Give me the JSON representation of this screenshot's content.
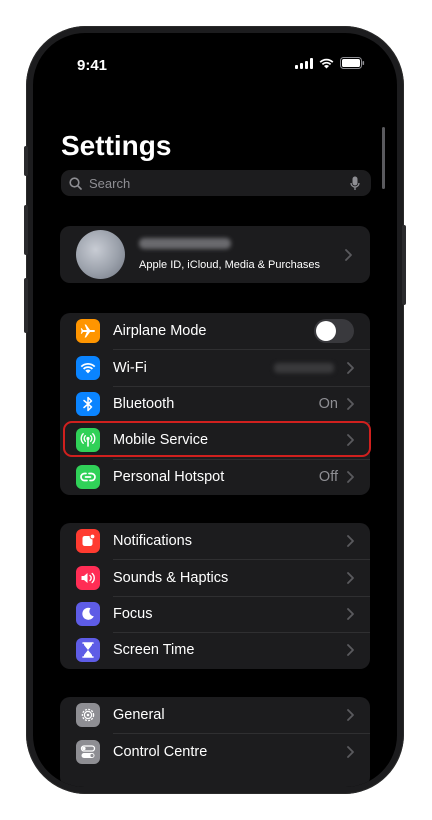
{
  "status_bar": {
    "time": "9:41"
  },
  "header": {
    "title": "Settings"
  },
  "search": {
    "placeholder": "Search"
  },
  "profile": {
    "subtitle": "Apple ID, iCloud, Media & Purchases"
  },
  "groups": {
    "connectivity": [
      {
        "label": "Airplane Mode",
        "icon": "airplane-icon",
        "color": "#ff9500"
      },
      {
        "label": "Wi-Fi",
        "icon": "wifi-icon",
        "color": "#0a84ff"
      },
      {
        "label": "Bluetooth",
        "value": "On",
        "icon": "bluetooth-icon",
        "color": "#0a84ff"
      },
      {
        "label": "Mobile Service",
        "icon": "antenna-icon",
        "color": "#30d158"
      },
      {
        "label": "Personal Hotspot",
        "value": "Off",
        "icon": "hotspot-icon",
        "color": "#30d158"
      }
    ],
    "notifications": [
      {
        "label": "Notifications",
        "icon": "bell-icon",
        "color": "#ff3b30"
      },
      {
        "label": "Sounds & Haptics",
        "icon": "speaker-icon",
        "color": "#ff2d55"
      },
      {
        "label": "Focus",
        "icon": "moon-icon",
        "color": "#5e5ce6"
      },
      {
        "label": "Screen Time",
        "icon": "hourglass-icon",
        "color": "#5e5ce6"
      }
    ],
    "general": [
      {
        "label": "General",
        "icon": "gear-icon",
        "color": "#8e8e93"
      },
      {
        "label": "Control Centre",
        "icon": "switches-icon",
        "color": "#8e8e93"
      }
    ]
  },
  "highlight_color": "#d0201e"
}
